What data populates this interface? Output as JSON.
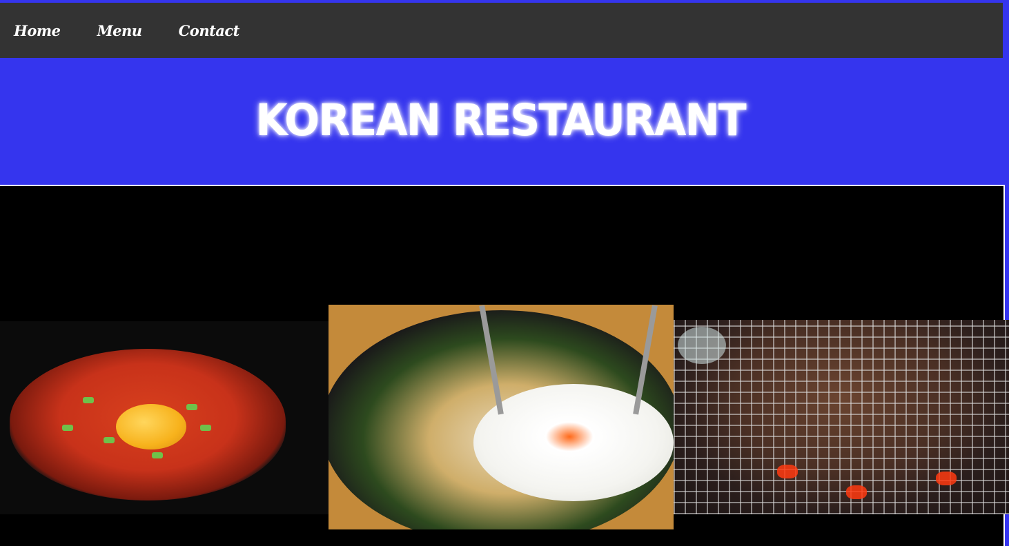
{
  "nav": {
    "items": [
      {
        "label": "Home"
      },
      {
        "label": "Menu"
      },
      {
        "label": "Contact"
      }
    ]
  },
  "hero": {
    "title": "KOREAN RESTAURANT"
  },
  "gallery": {
    "images": [
      {
        "alt": "Kimchi stew with egg yolk",
        "icon": "soup-photo"
      },
      {
        "alt": "Bibimbap with fried egg",
        "icon": "bibimbap-photo"
      },
      {
        "alt": "Grilled bulgogi",
        "icon": "bulgogi-photo"
      }
    ]
  },
  "colors": {
    "background": "#3535ee",
    "navbar": "#333333",
    "gallery": "#000000",
    "text": "#ffffff"
  }
}
